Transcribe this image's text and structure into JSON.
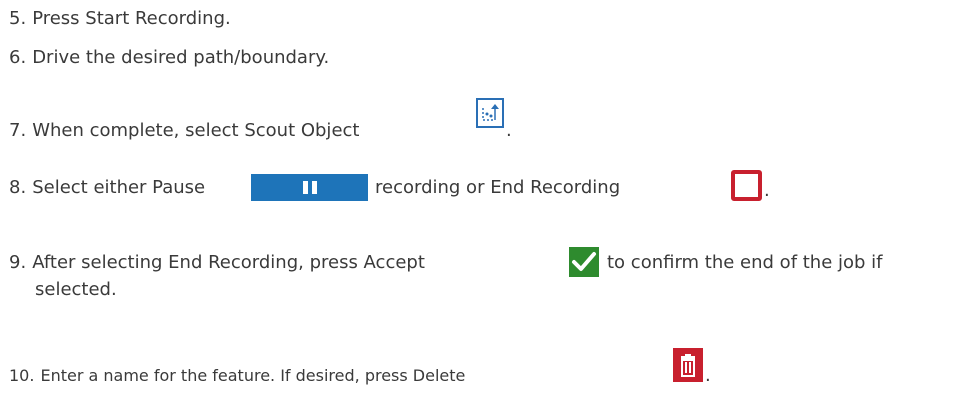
{
  "steps": [
    {
      "num": "5.",
      "text": "Press Start Recording."
    },
    {
      "num": "6.",
      "text": "Drive the desired path/boundary."
    },
    {
      "num": "7.",
      "text": "When complete, select Scout Object",
      "after": "."
    },
    {
      "num": "8.",
      "text": "Select either Pause",
      "middle": "recording or End Recording",
      "after": "."
    },
    {
      "num": "9.",
      "text": "After selecting End Recording, press Accept",
      "after": "to confirm the end of the job if",
      "line2": "selected."
    },
    {
      "num": "10.",
      "text": "Enter a name for the feature. If desired, press Delete",
      "after": "."
    }
  ],
  "colors": {
    "text": "#3a3a3a",
    "pause_blue": "#1e74b9",
    "end_red": "#c8202e",
    "accept_green": "#2e8b2e",
    "scout_blue": "#2a6fb5"
  },
  "icons": {
    "scout": "scout-object-icon",
    "pause": "pause-icon",
    "end": "end-recording-icon",
    "accept": "checkmark-icon",
    "delete": "trash-icon"
  }
}
